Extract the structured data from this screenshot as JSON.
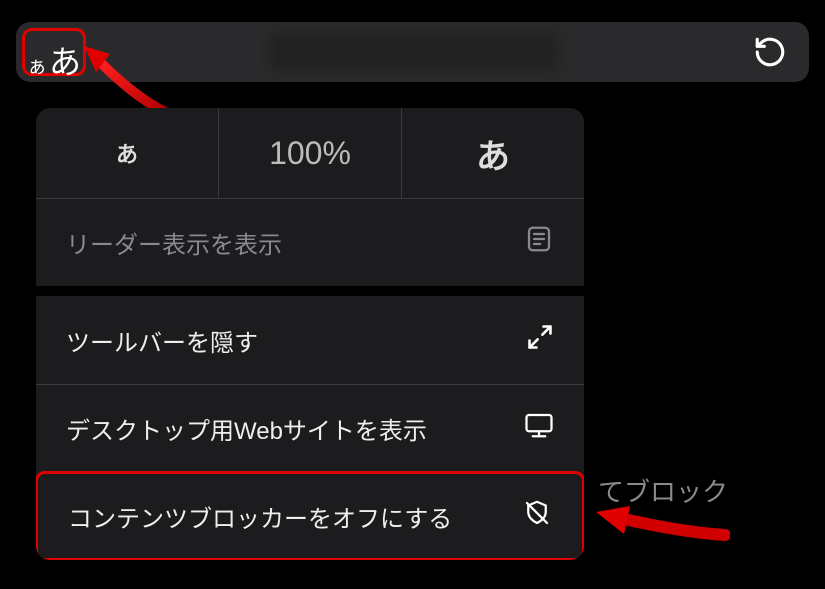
{
  "urlbar": {
    "aa_small": "ぁ",
    "aa_large": "あ"
  },
  "zoom": {
    "small": "あ",
    "percent": "100%",
    "large": "あ"
  },
  "menu": {
    "reader_label": "リーダー表示を表示",
    "hide_toolbar_label": "ツールバーを隠す",
    "desktop_site_label": "デスクトップ用Webサイトを表示",
    "content_blocker_off_label": "コンテンツブロッカーをオフにする"
  },
  "background_text": "てブロック"
}
